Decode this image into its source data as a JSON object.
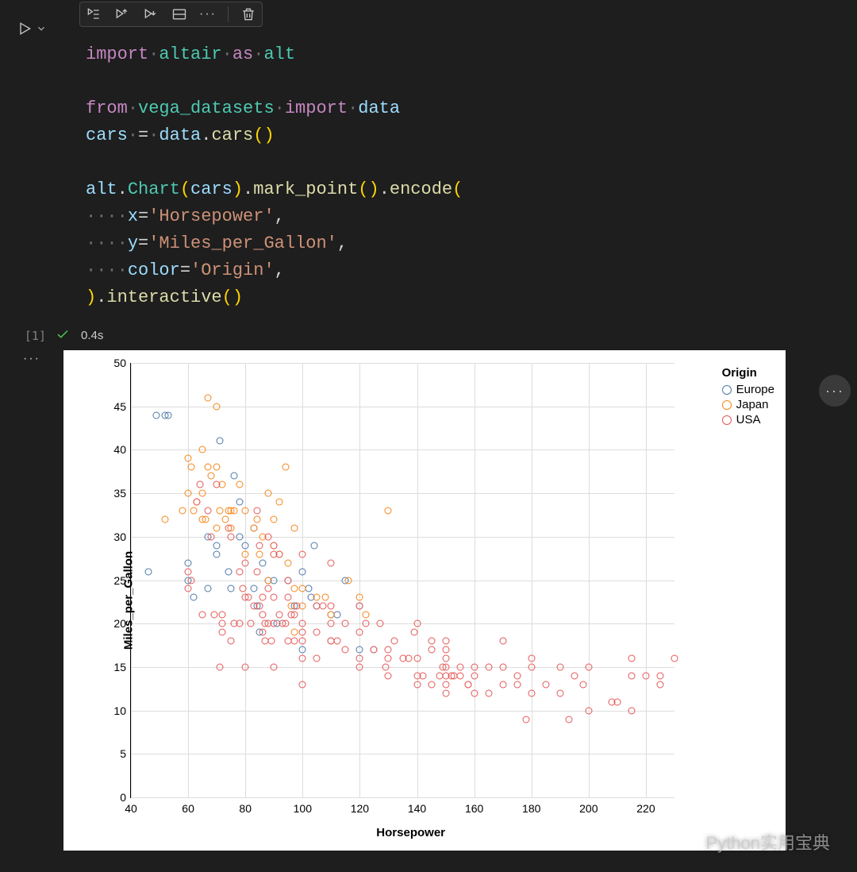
{
  "toolbar": {
    "run_by_line": "run-by-line",
    "run_above": "run-above",
    "run_below": "run-below",
    "split": "split-cell",
    "more": "more-actions",
    "delete": "delete-cell"
  },
  "cell": {
    "execution_count": "[1]",
    "timing": "0.4s",
    "code_tokens": [
      [
        [
          "kw",
          "import"
        ],
        [
          "dot",
          "·"
        ],
        [
          "mod",
          "altair"
        ],
        [
          "dot",
          "·"
        ],
        [
          "kw",
          "as"
        ],
        [
          "dot",
          "·"
        ],
        [
          "mod",
          "alt"
        ]
      ],
      [],
      [
        [
          "kw",
          "from"
        ],
        [
          "dot",
          "·"
        ],
        [
          "mod",
          "vega_datasets"
        ],
        [
          "dot",
          "·"
        ],
        [
          "kw",
          "import"
        ],
        [
          "dot",
          "·"
        ],
        [
          "nm",
          "data"
        ]
      ],
      [
        [
          "nm",
          "cars"
        ],
        [
          "dot",
          "·"
        ],
        [
          "op",
          "="
        ],
        [
          "dot",
          "·"
        ],
        [
          "nm",
          "data"
        ],
        [
          "op",
          "."
        ],
        [
          "fn",
          "cars"
        ],
        [
          "paren",
          "()"
        ]
      ],
      [],
      [
        [
          "nm",
          "alt"
        ],
        [
          "op",
          "."
        ],
        [
          "cls",
          "Chart"
        ],
        [
          "paren",
          "("
        ],
        [
          "nm",
          "cars"
        ],
        [
          "paren",
          ")"
        ],
        [
          "op",
          "."
        ],
        [
          "fn",
          "mark_point"
        ],
        [
          "paren",
          "()"
        ],
        [
          "op",
          "."
        ],
        [
          "fn",
          "encode"
        ],
        [
          "paren",
          "("
        ]
      ],
      [
        [
          "dot",
          "····"
        ],
        [
          "nm",
          "x"
        ],
        [
          "op",
          "="
        ],
        [
          "str",
          "'Horsepower'"
        ],
        [
          "op",
          ","
        ]
      ],
      [
        [
          "dot",
          "····"
        ],
        [
          "nm",
          "y"
        ],
        [
          "op",
          "="
        ],
        [
          "str",
          "'Miles_per_Gallon'"
        ],
        [
          "op",
          ","
        ]
      ],
      [
        [
          "dot",
          "····"
        ],
        [
          "nm",
          "color"
        ],
        [
          "op",
          "="
        ],
        [
          "str",
          "'Origin'"
        ],
        [
          "op",
          ","
        ]
      ],
      [
        [
          "paren",
          ")"
        ],
        [
          "op",
          "."
        ],
        [
          "fn",
          "interactive"
        ],
        [
          "paren",
          "()"
        ]
      ]
    ]
  },
  "chart_data": {
    "type": "scatter",
    "xlabel": "Horsepower",
    "ylabel": "Miles_per_Gallon",
    "xlim": [
      40,
      230
    ],
    "ylim": [
      0,
      50
    ],
    "xticks": [
      40,
      60,
      80,
      100,
      120,
      140,
      160,
      180,
      200,
      220
    ],
    "yticks": [
      0,
      5,
      10,
      15,
      20,
      25,
      30,
      35,
      40,
      45,
      50
    ],
    "legend_title": "Origin",
    "series": [
      {
        "name": "Europe",
        "color": "#4c78a8",
        "points": [
          [
            46,
            26
          ],
          [
            49,
            44
          ],
          [
            52,
            44
          ],
          [
            53,
            44
          ],
          [
            60,
            25
          ],
          [
            62,
            23
          ],
          [
            60,
            27
          ],
          [
            67,
            30
          ],
          [
            67,
            24
          ],
          [
            70,
            28
          ],
          [
            70,
            29
          ],
          [
            71,
            41
          ],
          [
            74,
            26
          ],
          [
            75,
            24
          ],
          [
            76,
            37
          ],
          [
            78,
            30
          ],
          [
            78,
            34
          ],
          [
            80,
            29
          ],
          [
            83,
            31
          ],
          [
            83,
            24
          ],
          [
            84,
            22
          ],
          [
            85,
            19
          ],
          [
            86,
            27
          ],
          [
            88,
            25
          ],
          [
            90,
            25
          ],
          [
            91,
            20
          ],
          [
            95,
            25
          ],
          [
            97,
            22
          ],
          [
            100,
            26
          ],
          [
            100,
            17
          ],
          [
            102,
            24
          ],
          [
            103,
            23
          ],
          [
            104,
            29
          ],
          [
            105,
            22
          ],
          [
            110,
            21
          ],
          [
            112,
            21
          ],
          [
            115,
            25
          ],
          [
            120,
            22
          ],
          [
            120,
            17
          ],
          [
            125,
            17
          ]
        ]
      },
      {
        "name": "Japan",
        "color": "#f58518",
        "points": [
          [
            52,
            32
          ],
          [
            58,
            33
          ],
          [
            60,
            35
          ],
          [
            60,
            39
          ],
          [
            61,
            38
          ],
          [
            62,
            33
          ],
          [
            63,
            34
          ],
          [
            65,
            35
          ],
          [
            65,
            32
          ],
          [
            65,
            40
          ],
          [
            66,
            32
          ],
          [
            67,
            46
          ],
          [
            67,
            38
          ],
          [
            68,
            37
          ],
          [
            70,
            45
          ],
          [
            70,
            38
          ],
          [
            70,
            31
          ],
          [
            71,
            33
          ],
          [
            72,
            36
          ],
          [
            73,
            32
          ],
          [
            74,
            33
          ],
          [
            75,
            31
          ],
          [
            75,
            33
          ],
          [
            76,
            33
          ],
          [
            78,
            36
          ],
          [
            80,
            33
          ],
          [
            80,
            28
          ],
          [
            83,
            31
          ],
          [
            84,
            32
          ],
          [
            85,
            28
          ],
          [
            86,
            30
          ],
          [
            88,
            35
          ],
          [
            88,
            25
          ],
          [
            90,
            32
          ],
          [
            90,
            29
          ],
          [
            92,
            28
          ],
          [
            92,
            34
          ],
          [
            94,
            38
          ],
          [
            95,
            27
          ],
          [
            96,
            22
          ],
          [
            97,
            24
          ],
          [
            97,
            31
          ],
          [
            97,
            19
          ],
          [
            100,
            24
          ],
          [
            100,
            22
          ],
          [
            105,
            23
          ],
          [
            108,
            23
          ],
          [
            110,
            21
          ],
          [
            116,
            25
          ],
          [
            120,
            23
          ],
          [
            122,
            21
          ],
          [
            130,
            33
          ]
        ]
      },
      {
        "name": "USA",
        "color": "#e45756",
        "points": [
          [
            60,
            24
          ],
          [
            60,
            26
          ],
          [
            61,
            25
          ],
          [
            63,
            34
          ],
          [
            64,
            36
          ],
          [
            65,
            21
          ],
          [
            67,
            33
          ],
          [
            68,
            30
          ],
          [
            69,
            21
          ],
          [
            70,
            36
          ],
          [
            71,
            15
          ],
          [
            72,
            21
          ],
          [
            72,
            20
          ],
          [
            72,
            19
          ],
          [
            74,
            31
          ],
          [
            75,
            18
          ],
          [
            75,
            30
          ],
          [
            76,
            20
          ],
          [
            78,
            20
          ],
          [
            78,
            26
          ],
          [
            79,
            24
          ],
          [
            80,
            27
          ],
          [
            80,
            23
          ],
          [
            80,
            15
          ],
          [
            81,
            23
          ],
          [
            82,
            20
          ],
          [
            83,
            22
          ],
          [
            84,
            33
          ],
          [
            84,
            26
          ],
          [
            85,
            22
          ],
          [
            85,
            29
          ],
          [
            86,
            19
          ],
          [
            86,
            21
          ],
          [
            86,
            23
          ],
          [
            87,
            20
          ],
          [
            87,
            18
          ],
          [
            88,
            30
          ],
          [
            88,
            24
          ],
          [
            88,
            20
          ],
          [
            89,
            18
          ],
          [
            90,
            29
          ],
          [
            90,
            20
          ],
          [
            90,
            15
          ],
          [
            90,
            28
          ],
          [
            90,
            23
          ],
          [
            92,
            21
          ],
          [
            92,
            28
          ],
          [
            93,
            20
          ],
          [
            94,
            20
          ],
          [
            95,
            25
          ],
          [
            95,
            18
          ],
          [
            95,
            23
          ],
          [
            96,
            21
          ],
          [
            97,
            18
          ],
          [
            97,
            21
          ],
          [
            98,
            22
          ],
          [
            100,
            16
          ],
          [
            100,
            28
          ],
          [
            100,
            20
          ],
          [
            100,
            18
          ],
          [
            100,
            13
          ],
          [
            100,
            19
          ],
          [
            105,
            19
          ],
          [
            105,
            16
          ],
          [
            105,
            22
          ],
          [
            107,
            22
          ],
          [
            110,
            18
          ],
          [
            110,
            22
          ],
          [
            110,
            20
          ],
          [
            110,
            27
          ],
          [
            110,
            18
          ],
          [
            112,
            18
          ],
          [
            115,
            20
          ],
          [
            115,
            17
          ],
          [
            120,
            22
          ],
          [
            120,
            16
          ],
          [
            120,
            15
          ],
          [
            120,
            19
          ],
          [
            122,
            20
          ],
          [
            125,
            17
          ],
          [
            127,
            20
          ],
          [
            130,
            17
          ],
          [
            129,
            15
          ],
          [
            130,
            16
          ],
          [
            130,
            14
          ],
          [
            132,
            18
          ],
          [
            135,
            16
          ],
          [
            137,
            16
          ],
          [
            139,
            19
          ],
          [
            140,
            14
          ],
          [
            140,
            20
          ],
          [
            140,
            16
          ],
          [
            140,
            13
          ],
          [
            142,
            14
          ],
          [
            145,
            17
          ],
          [
            145,
            18
          ],
          [
            145,
            13
          ],
          [
            148,
            14
          ],
          [
            149,
            15
          ],
          [
            150,
            14
          ],
          [
            150,
            12
          ],
          [
            150,
            17
          ],
          [
            150,
            15
          ],
          [
            150,
            16
          ],
          [
            150,
            18
          ],
          [
            150,
            13
          ],
          [
            152,
            14
          ],
          [
            153,
            14
          ],
          [
            155,
            15
          ],
          [
            155,
            14
          ],
          [
            158,
            13
          ],
          [
            158,
            13
          ],
          [
            160,
            12
          ],
          [
            160,
            14
          ],
          [
            160,
            15
          ],
          [
            165,
            15
          ],
          [
            165,
            12
          ],
          [
            170,
            13
          ],
          [
            170,
            18
          ],
          [
            170,
            15
          ],
          [
            175,
            13
          ],
          [
            175,
            14
          ],
          [
            178,
            9
          ],
          [
            180,
            12
          ],
          [
            180,
            15
          ],
          [
            180,
            16
          ],
          [
            185,
            13
          ],
          [
            190,
            12
          ],
          [
            190,
            15
          ],
          [
            193,
            9
          ],
          [
            195,
            14
          ],
          [
            198,
            13
          ],
          [
            200,
            10
          ],
          [
            200,
            15
          ],
          [
            208,
            11
          ],
          [
            210,
            11
          ],
          [
            215,
            14
          ],
          [
            215,
            10
          ],
          [
            215,
            16
          ],
          [
            220,
            14
          ],
          [
            225,
            13
          ],
          [
            225,
            14
          ],
          [
            230,
            16
          ]
        ]
      }
    ]
  },
  "watermark": "Python实用宝典"
}
